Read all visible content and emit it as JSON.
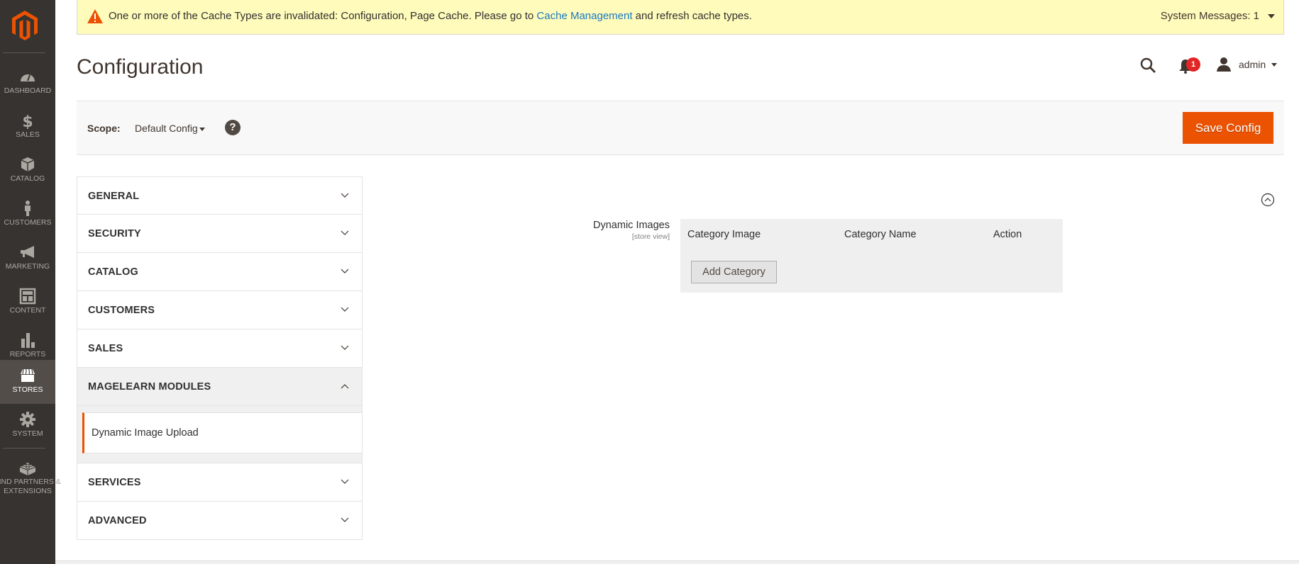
{
  "nav": {
    "logo": "magento-logo",
    "items": [
      {
        "label": "DASHBOARD",
        "icon": "dashboard-gauge-icon"
      },
      {
        "label": "SALES",
        "icon": "dollar-icon"
      },
      {
        "label": "CATALOG",
        "icon": "box-icon"
      },
      {
        "label": "CUSTOMERS",
        "icon": "person-icon"
      },
      {
        "label": "MARKETING",
        "icon": "megaphone-icon"
      },
      {
        "label": "CONTENT",
        "icon": "layout-icon"
      },
      {
        "label": "REPORTS",
        "icon": "bar-chart-icon"
      },
      {
        "label": "STORES",
        "icon": "storefront-icon",
        "active": true
      },
      {
        "label": "SYSTEM",
        "icon": "gear-icon"
      },
      {
        "label": "FIND PARTNERS & EXTENSIONS",
        "icon": "lego-brick-icon"
      }
    ]
  },
  "banner": {
    "message_prefix": "One or more of the Cache Types are invalidated: Configuration, Page Cache. Please go to ",
    "link_text": "Cache Management",
    "message_suffix": " and refresh cache types.",
    "system_messages": "System Messages: 1"
  },
  "header": {
    "title": "Configuration",
    "notification_count": "1",
    "user_name": "admin"
  },
  "scope": {
    "label": "Scope:",
    "value": "Default Config",
    "help": "?",
    "save_label": "Save Config"
  },
  "tabs": [
    {
      "label": "GENERAL"
    },
    {
      "label": "SECURITY"
    },
    {
      "label": "CATALOG"
    },
    {
      "label": "CUSTOMERS"
    },
    {
      "label": "SALES"
    },
    {
      "label": "MAGELEARN MODULES",
      "open": true,
      "children": [
        {
          "label": "Dynamic Image Upload",
          "active": true
        }
      ]
    },
    {
      "label": "SERVICES"
    },
    {
      "label": "ADVANCED"
    }
  ],
  "field": {
    "label": "Dynamic Images",
    "scope": "[store view]",
    "columns": [
      "Category Image",
      "Category Name",
      "Action"
    ],
    "add_button": "Add Category"
  },
  "colors": {
    "accent": "#eb5202",
    "nav_bg": "#373330",
    "banner_bg": "#fffbbb",
    "link": "#1979c3",
    "badge": "#e22626"
  }
}
